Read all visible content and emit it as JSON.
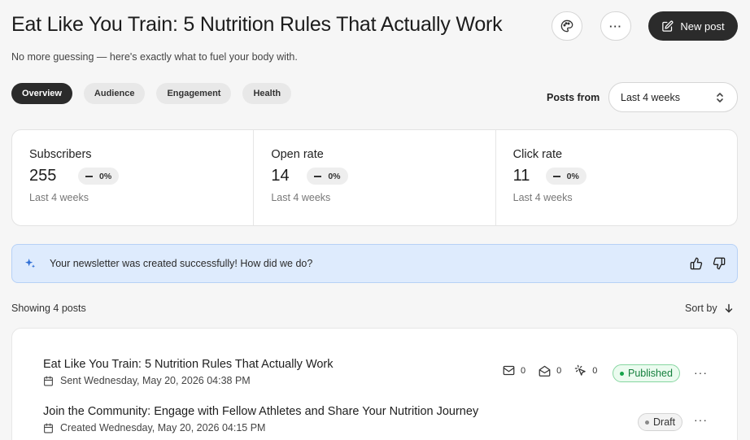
{
  "header": {
    "title": "Eat Like You Train: 5 Nutrition Rules That Actually Work",
    "subtitle": "No more guessing — here's exactly what to fuel your body with.",
    "new_post_label": "New post",
    "more_label": "···"
  },
  "tabs": [
    {
      "label": "Overview",
      "active": true
    },
    {
      "label": "Audience",
      "active": false
    },
    {
      "label": "Engagement",
      "active": false
    },
    {
      "label": "Health",
      "active": false
    }
  ],
  "filter": {
    "label": "Posts from",
    "selected": "Last 4 weeks"
  },
  "stats": [
    {
      "label": "Subscribers",
      "value": "255",
      "change": "0%",
      "period": "Last 4 weeks"
    },
    {
      "label": "Open rate",
      "value": "14",
      "change": "0%",
      "period": "Last 4 weeks"
    },
    {
      "label": "Click rate",
      "value": "11",
      "change": "0%",
      "period": "Last 4 weeks"
    }
  ],
  "banner": {
    "text": "Your newsletter was created successfully! How did we do?"
  },
  "list_header": {
    "showing": "Showing 4 posts",
    "sort_label": "Sort by"
  },
  "posts": [
    {
      "title": "Eat Like You Train: 5 Nutrition Rules That Actually Work",
      "meta": "Sent Wednesday, May 20, 2026 04:38 PM",
      "sent": "0",
      "opened": "0",
      "clicked": "0",
      "status": "Published",
      "more": "···"
    },
    {
      "title": "Join the Community: Engage with Fellow Athletes and Share Your Nutrition Journey",
      "meta": "Created Wednesday, May 20, 2026 04:15 PM",
      "status": "Draft",
      "more": "···"
    }
  ],
  "colors": {
    "primary_button": "#2b2b2b",
    "banner_bg": "#deebfd",
    "banner_border": "#b6d1f6",
    "sparkle": "#2f6fd6",
    "published_green": "#15803d"
  },
  "icons": {
    "palette": "palette-icon",
    "more": "more-horizontal-icon",
    "new_post": "edit-square-icon",
    "select": "chevron-up-down-icon",
    "sparkle": "sparkle-icon",
    "thumbs_up": "thumbs-up-icon",
    "thumbs_down": "thumbs-down-icon",
    "sort": "arrow-down-icon",
    "calendar": "calendar-icon",
    "mail": "mail-icon",
    "mail_open": "mail-open-icon",
    "click": "cursor-click-icon"
  }
}
